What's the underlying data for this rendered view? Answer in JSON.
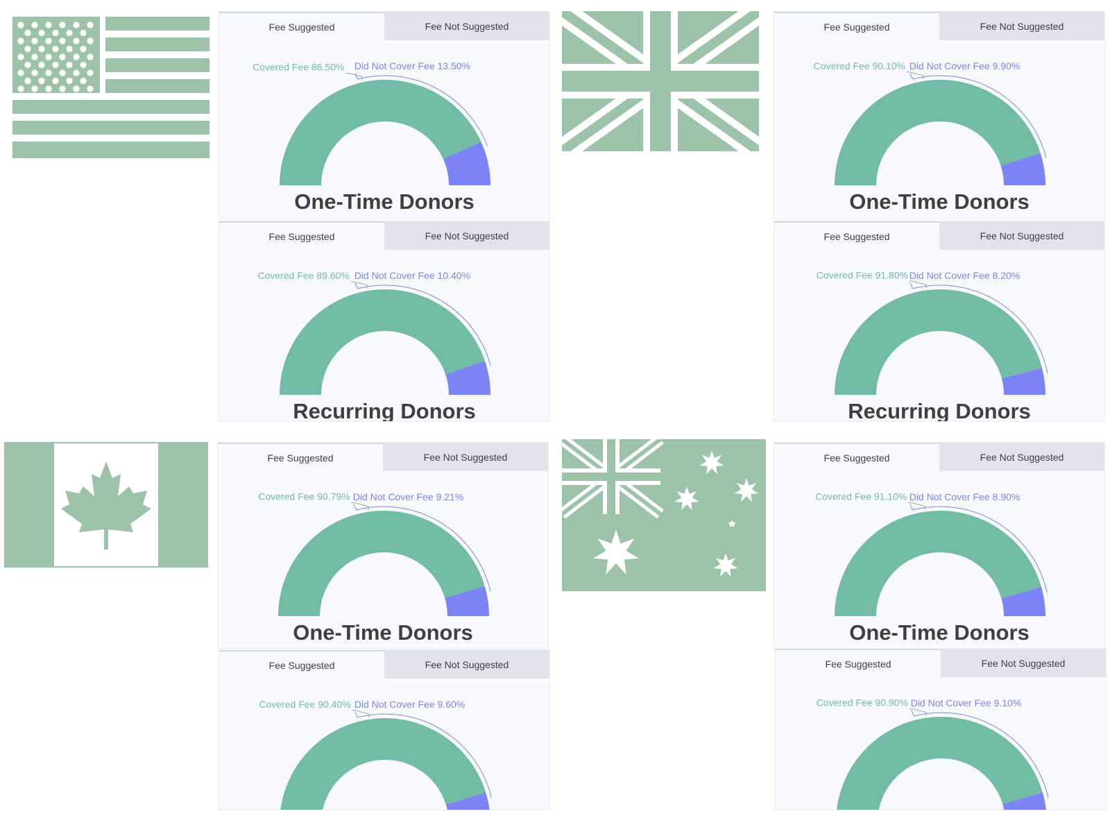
{
  "colors": {
    "covered": "#72bba5",
    "not_covered": "#7b83f5",
    "flag": "#9cc3aa",
    "flag_light": "#ffffff",
    "tab_bg": "#e2e3e6",
    "card_bg": "#f7f9fc",
    "text": "#3f3f3f"
  },
  "flags": {
    "usa": "us-flag-icon",
    "uk": "uk-flag-icon",
    "canada": "canada-flag-icon",
    "australia": "australia-flag-icon"
  },
  "chart_data": [
    {
      "type": "pie",
      "title": "One-Time Donors",
      "tabs": [
        "Fee Suggested",
        "Fee Not Suggested"
      ],
      "active_tab": "Fee Suggested",
      "covered_label": "Covered Fee 86.50%",
      "not_covered_label": "Did Not Cover Fee 13.50%",
      "values": [
        86.5,
        13.5
      ]
    },
    {
      "type": "pie",
      "title": "Recurring Donors",
      "tabs": [
        "Fee Suggested",
        "Fee Not Suggested"
      ],
      "active_tab": "Fee Suggested",
      "covered_label": "Covered Fee 89.60%",
      "not_covered_label": "Did Not Cover Fee 10.40%",
      "values": [
        89.6,
        10.4
      ]
    },
    {
      "type": "pie",
      "title": "One-Time Donors",
      "tabs": [
        "Fee Suggested",
        "Fee Not Suggested"
      ],
      "active_tab": "Fee Suggested",
      "covered_label": "Covered Fee 90.10%",
      "not_covered_label": "Did Not Cover Fee 9.90%",
      "values": [
        90.1,
        9.9
      ]
    },
    {
      "type": "pie",
      "title": "Recurring Donors",
      "tabs": [
        "Fee Suggested",
        "Fee Not Suggested"
      ],
      "active_tab": "Fee Suggested",
      "covered_label": "Covered Fee 91.80%",
      "not_covered_label": "Did Not Cover Fee 8.20%",
      "values": [
        91.8,
        8.2
      ]
    },
    {
      "type": "pie",
      "title": "One-Time Donors",
      "tabs": [
        "Fee Suggested",
        "Fee Not Suggested"
      ],
      "active_tab": "Fee Suggested",
      "covered_label": "Covered Fee 90.79%",
      "not_covered_label": "Did Not Cover Fee 9.21%",
      "values": [
        90.79,
        9.21
      ]
    },
    {
      "type": "pie",
      "title": "",
      "tabs": [
        "Fee Suggested",
        "Fee Not Suggested"
      ],
      "active_tab": "Fee Suggested",
      "covered_label": "Covered Fee 90.40%",
      "not_covered_label": "Did Not Cover Fee 9.60%",
      "values": [
        90.4,
        9.6
      ]
    },
    {
      "type": "pie",
      "title": "One-Time Donors",
      "tabs": [
        "Fee Suggested",
        "Fee Not Suggested"
      ],
      "active_tab": "Fee Suggested",
      "covered_label": "Covered Fee 91.10%",
      "not_covered_label": "Did Not Cover Fee 8.90%",
      "values": [
        91.1,
        8.9
      ]
    },
    {
      "type": "pie",
      "title": "",
      "tabs": [
        "Fee Suggested",
        "Fee Not Suggested"
      ],
      "active_tab": "Fee Suggested",
      "covered_label": "Covered Fee 90.90%",
      "not_covered_label": "Did Not Cover Fee 9.10%",
      "values": [
        90.9,
        9.1
      ]
    }
  ]
}
